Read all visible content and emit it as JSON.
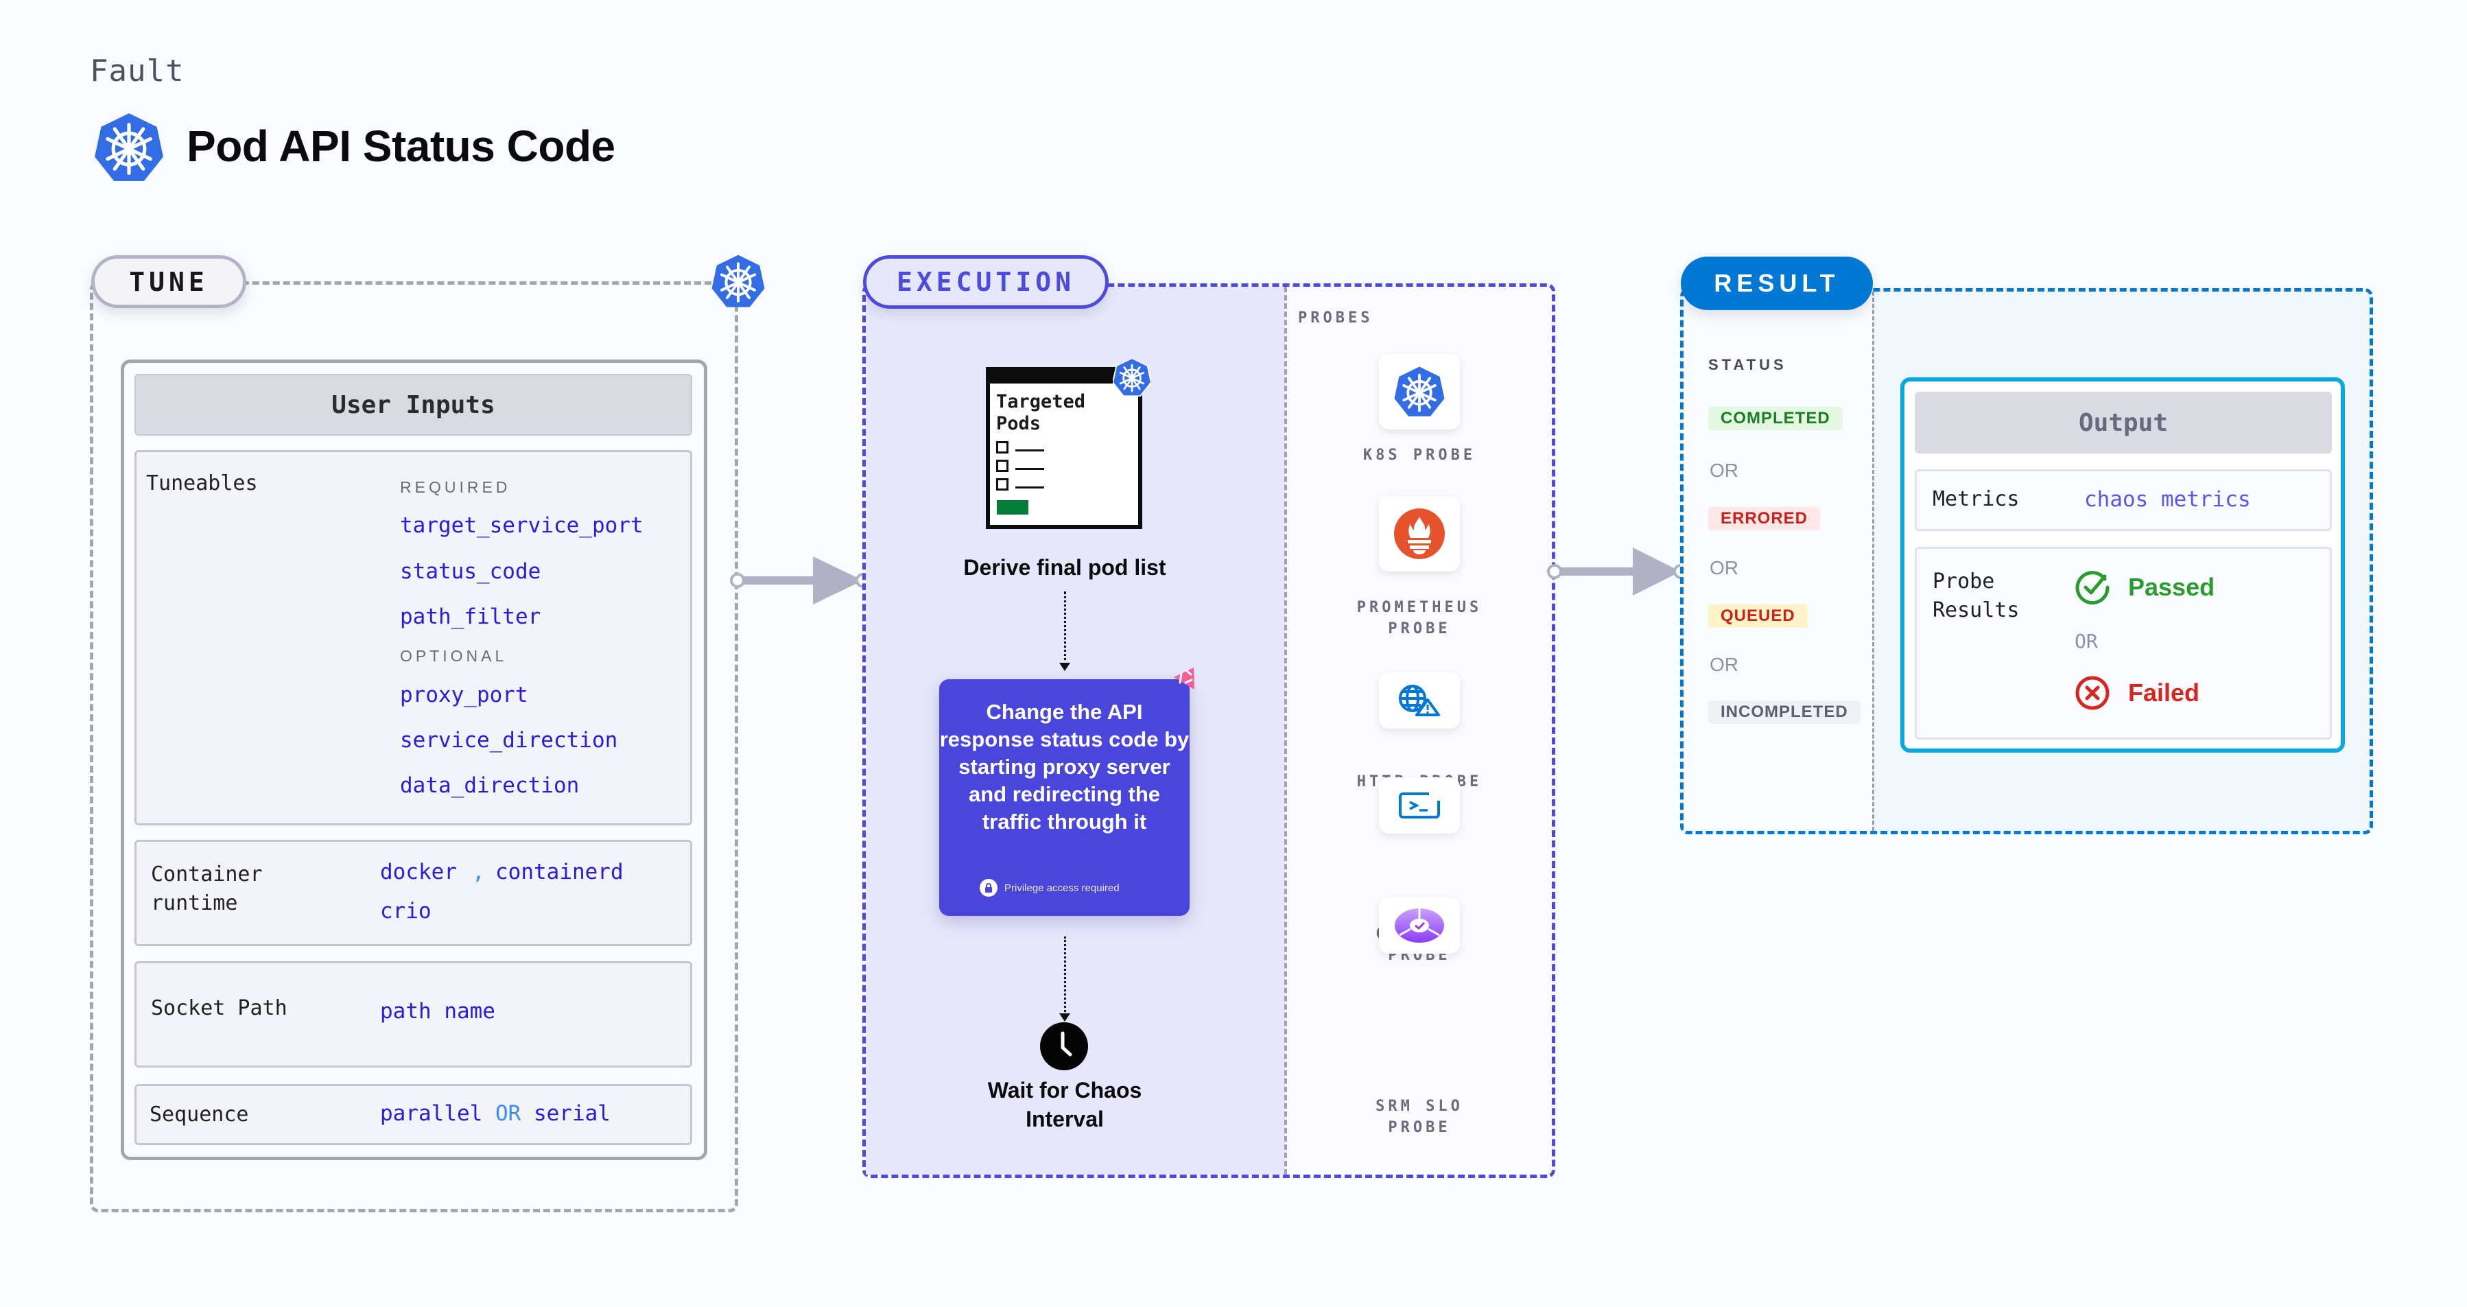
{
  "header": {
    "eyebrow": "Fault",
    "title": "Pod API Status Code",
    "logo_icon": "kubernetes-icon"
  },
  "tune": {
    "label": "TUNE",
    "badge_icon": "kubernetes-icon",
    "user_inputs": {
      "title": "User Inputs",
      "tuneables": {
        "label": "Tuneables",
        "required_caption": "REQUIRED",
        "required": [
          "target_service_port",
          "status_code",
          "path_filter"
        ],
        "optional_caption": "OPTIONAL",
        "optional": [
          "proxy_port",
          "service_direction",
          "data_direction"
        ]
      },
      "container_runtime": {
        "label_line1": "Container",
        "label_line2": "runtime",
        "values": [
          "docker",
          "containerd",
          "crio"
        ],
        "separator": ","
      },
      "socket_path": {
        "label": "Socket Path",
        "value": "path name"
      },
      "sequence": {
        "label": "Sequence",
        "option_a": "parallel",
        "or": "OR",
        "option_b": "serial"
      }
    }
  },
  "execution": {
    "label": "EXECUTION",
    "pods_card": {
      "title_line1": "Targeted",
      "title_line2": "Pods",
      "badge_icon": "kubernetes-icon"
    },
    "steps": [
      {
        "label": "Derive final pod list"
      },
      {
        "label": "Change the API response status code by starting proxy server and redirecting the traffic through it",
        "note": "Privilege access required",
        "note_icon": "lock-icon",
        "corner_icon": "chaos-fault-icon"
      },
      {
        "label_line1": "Wait for Chaos",
        "label_line2": "Interval",
        "icon": "clock-icon"
      }
    ],
    "probes": {
      "caption": "PROBES",
      "items": [
        {
          "line1": "K8S PROBE",
          "line2": "",
          "icon": "kubernetes-icon"
        },
        {
          "line1": "PROMETHEUS",
          "line2": "PROBE",
          "icon": "prometheus-icon"
        },
        {
          "line1": "HTTP PROBE",
          "line2": "",
          "icon": "globe-warning-icon"
        },
        {
          "line1": "COMMAND",
          "line2": "PROBE",
          "icon": "terminal-icon"
        },
        {
          "line1": "SRM SLO",
          "line2": "PROBE",
          "icon": "slo-icon"
        }
      ]
    }
  },
  "result": {
    "label": "RESULT",
    "status": {
      "caption": "STATUS",
      "or": "OR",
      "badges": [
        {
          "text": "COMPLETED",
          "fg": "#1b7d26",
          "bg": "#e3f7e1"
        },
        {
          "text": "ERRORED",
          "fg": "#c8221d",
          "bg": "#fde8e8"
        },
        {
          "text": "QUEUED",
          "fg": "#c8221d",
          "bg": "#fff3c8"
        },
        {
          "text": "INCOMPLETED",
          "fg": "#5c5e70",
          "bg": "#f0f1f6"
        }
      ]
    },
    "output": {
      "title": "Output",
      "metrics_label": "Metrics",
      "metrics_value": "chaos metrics",
      "probe_results_line1": "Probe",
      "probe_results_line2": "Results",
      "passed": "Passed",
      "or": "OR",
      "failed": "Failed"
    }
  },
  "colors": {
    "tune_border": "#a4a6ad",
    "execution_accent": "#4d4ade",
    "result_accent": "#0278d5",
    "value_text": "#2a1be0",
    "passed": "#2a9b2e",
    "failed": "#d7261f",
    "kubernetes_blue": "#326de6"
  }
}
